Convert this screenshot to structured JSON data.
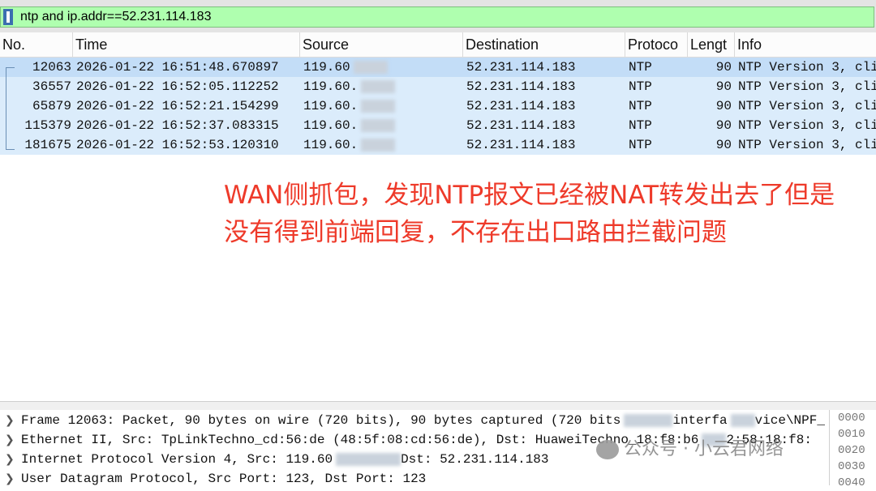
{
  "filter": {
    "text": "ntp and ip.addr==52.231.114.183"
  },
  "columns": [
    "No.",
    "Time",
    "Source",
    "Destination",
    "Protoco",
    "Lengt",
    "Info"
  ],
  "packets": [
    {
      "no": "12063",
      "time": "2026-01-22 16:51:48.670897",
      "src": "119.60",
      "dst": "52.231.114.183",
      "proto": "NTP",
      "len": "90",
      "info": "NTP Version 3, cli"
    },
    {
      "no": "36557",
      "time": "2026-01-22 16:52:05.112252",
      "src": "119.60.",
      "dst": "52.231.114.183",
      "proto": "NTP",
      "len": "90",
      "info": "NTP Version 3, cli"
    },
    {
      "no": "65879",
      "time": "2026-01-22 16:52:21.154299",
      "src": "119.60.",
      "dst": "52.231.114.183",
      "proto": "NTP",
      "len": "90",
      "info": "NTP Version 3, cli"
    },
    {
      "no": "115379",
      "time": "2026-01-22 16:52:37.083315",
      "src": "119.60.",
      "dst": "52.231.114.183",
      "proto": "NTP",
      "len": "90",
      "info": "NTP Version 3, cli"
    },
    {
      "no": "181675",
      "time": "2026-01-22 16:52:53.120310",
      "src": "119.60.",
      "dst": "52.231.114.183",
      "proto": "NTP",
      "len": "90",
      "info": "NTP Version 3, cli"
    }
  ],
  "annotation": {
    "line1": "WAN侧抓包，发现NTP报文已经被NAT转发出去了但是",
    "line2": "没有得到前端回复，不存在出口路由拦截问题"
  },
  "details": [
    "Frame 12063: Packet, 90 bytes on wire (720 bits), 90 bytes captured (720 bits",
    "Ethernet II, Src: TpLinkTechno_cd:56:de (48:5f:08:cd:56:de), Dst: HuaweiTechno_18:f8:b6",
    "Internet Protocol Version 4, Src: 119.60",
    "User Datagram Protocol, Src Port: 123, Dst Port: 123"
  ],
  "details_suffix": {
    "frame": "interfa",
    "frame2": "vice\\NPF_",
    "eth": "2:58:18:f8:",
    "ip": "Dst: 52.231.114.183"
  },
  "bytes": [
    "0000",
    "0010",
    "0020",
    "0030",
    "0040"
  ],
  "watermark": "公众号 · 小云君网络"
}
